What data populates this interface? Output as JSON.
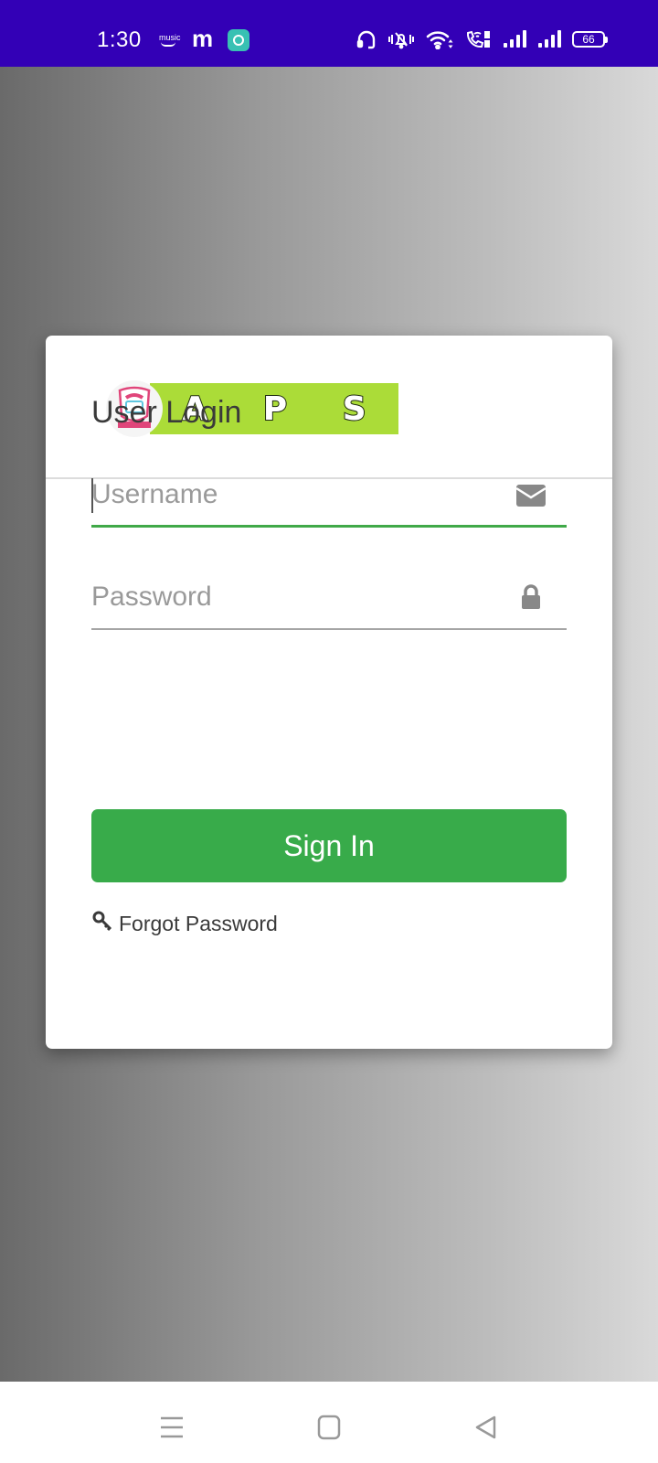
{
  "status_bar": {
    "time": "1:30",
    "left_icons": [
      "amazon-music-icon",
      "m-app-icon",
      "music-app-icon"
    ],
    "amazon_music_label": "music",
    "m_app_glyph": "m",
    "right_icons": [
      "headset-icon",
      "vibrate-bell-icon",
      "wifi-icon",
      "vowifi-call-icon",
      "signal-sim1-icon",
      "signal-sim2-icon",
      "battery-icon"
    ],
    "battery_level": "66"
  },
  "login": {
    "logo_text": "A P S",
    "title": "User Login",
    "username": {
      "placeholder": "Username",
      "value": "",
      "icon": "envelope-icon"
    },
    "password": {
      "placeholder": "Password",
      "value": "",
      "icon": "lock-icon"
    },
    "sign_in_label": "Sign In",
    "forgot_password_label": "Forgot Password",
    "forgot_icon": "key-icon"
  },
  "colors": {
    "status_bar": "#3300b6",
    "primary_green": "#38ab4a",
    "logo_green": "#abdc38",
    "text_dark": "#3a3a3a",
    "icon_gray": "#888888"
  },
  "nav_bar": {
    "buttons": [
      "menu-icon",
      "home-icon",
      "back-icon"
    ]
  }
}
